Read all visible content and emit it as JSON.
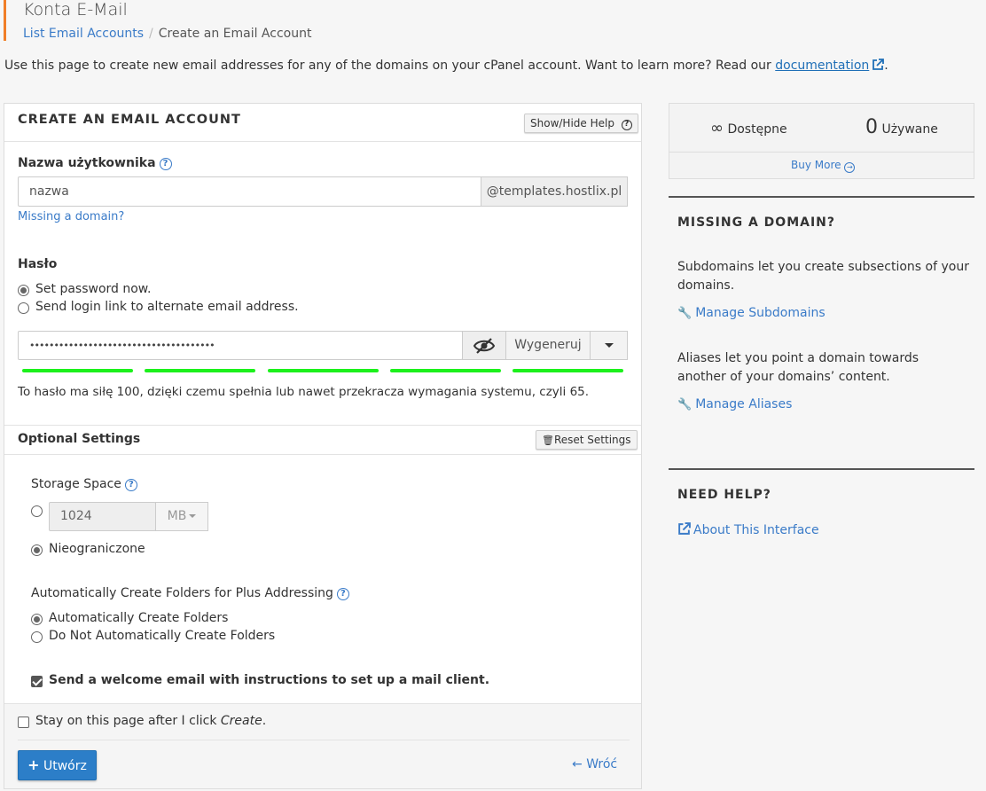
{
  "header": {
    "title": "Konta E-Mail",
    "breadcrumb": {
      "link": "List Email Accounts",
      "separator": "/",
      "current": "Create an Email Account"
    }
  },
  "intro": {
    "text": "Use this page to create new email addresses for any of the domains on your cPanel account. Want to learn more? Read our",
    "link": "documentation",
    "end": "."
  },
  "form": {
    "title": "CREATE AN EMAIL ACCOUNT",
    "help_toggle": "Show/Hide Help",
    "username": {
      "label": "Nazwa użytkownika",
      "value": "nazwa",
      "domain": "@templates.hostlix.pl",
      "missing_domain_link": "Missing a domain?"
    },
    "password": {
      "label": "Hasło",
      "option_set_now": "Set password now.",
      "option_send_link": "Send login link to alternate email address.",
      "value": "••••••••••••••••••••••••••••••••••••••",
      "generate_label": "Wygeneruj",
      "strength_text": "To hasło ma siłę 100, dzięki czemu spełnia lub nawet przekracza wymagania systemu, czyli 65.",
      "strength_color": "#1cf11c"
    },
    "optional": {
      "title": "Optional Settings",
      "reset_label": "Reset Settings",
      "storage_label": "Storage Space",
      "storage_value": "1024",
      "storage_unit": "MB",
      "unlimited_label": "Nieograniczone",
      "plus_label": "Automatically Create Folders for Plus Addressing",
      "plus_auto": "Automatically Create Folders",
      "plus_none": "Do Not Automatically Create Folders",
      "welcome_label": "Send a welcome email with instructions to set up a mail client."
    },
    "footer": {
      "stay_label_prefix": "Stay on this page after I click",
      "stay_label_em": "Create",
      "stay_label_suffix": ".",
      "create_label": "Utwórz",
      "back_label": "Wróć"
    }
  },
  "sidebar": {
    "available_symbol": "∞",
    "available_label": "Dostępne",
    "used_count": "0",
    "used_label": "Używane",
    "buy_more": "Buy More",
    "missing_title": "MISSING A DOMAIN?",
    "subdomains_text": "Subdomains let you create subsections of your domains.",
    "subdomains_link": "Manage Subdomains",
    "aliases_text": "Aliases let you point a domain towards another of your domains’ content.",
    "aliases_link": "Manage Aliases",
    "help_title": "NEED HELP?",
    "about_link": "About This Interface"
  },
  "colors": {
    "accent": "#f07e27",
    "link": "#3a7bc8",
    "primary": "#2c7ec8"
  }
}
